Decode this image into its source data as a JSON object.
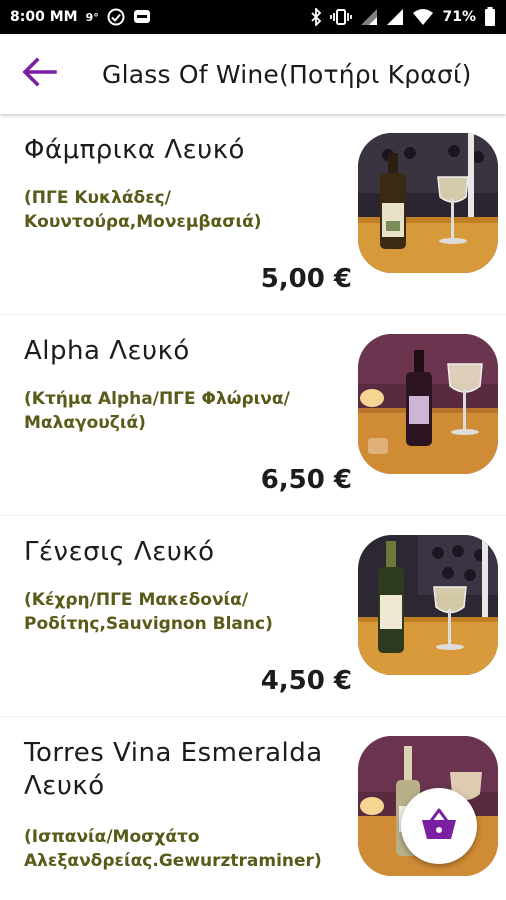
{
  "status_bar": {
    "time": "8:00 MM",
    "temp": "9°",
    "battery": "71%",
    "icons": [
      "check-circle-icon",
      "message-icon",
      "bluetooth-icon",
      "vibrate-icon",
      "signal-icon",
      "wifi-icon",
      "battery-icon"
    ]
  },
  "app_bar": {
    "title": "Glass Of Wine(Ποτήρι Κρασί)",
    "back_icon": "arrow-left-icon",
    "accent": "#7b1fa2"
  },
  "items": [
    {
      "name": "Φάμπρικα Λευκό",
      "description": "(ΠΓΕ Κυκλάδες/ Κουντούρα,Μονεμβασιά)",
      "price": "5,00 €"
    },
    {
      "name": "Alpha Λευκό",
      "description": "(Κτήμα Alpha/ΠΓΕ Φλώρινα/ Μαλαγουζιά)",
      "price": "6,50 €"
    },
    {
      "name": "Γένεσις Λευκό",
      "description": "(Κέχρη/ΠΓΕ Μακεδονία/ Ροδίτης,Sauvignon Blanc)",
      "price": "4,50 €"
    },
    {
      "name": "Torres Vina Esmeralda Λευκό",
      "description": "(Ισπανία/Μοσχάτο Αλεξανδρείας.Gewurztraminer)",
      "price": ""
    }
  ],
  "fab": {
    "icon": "basket-icon",
    "color": "#7b1fa2"
  }
}
